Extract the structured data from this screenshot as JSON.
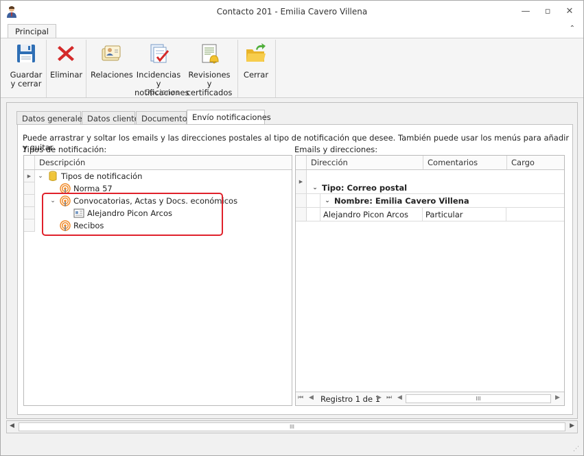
{
  "window": {
    "title": "Contacto 201 - Emilia Cavero Villena",
    "minimize": "—",
    "restore": "▫",
    "close": "✕"
  },
  "ribbon": {
    "tab": "Principal",
    "collapse": "⌃",
    "buttons": {
      "save_close": [
        "Guardar",
        "y cerrar"
      ],
      "delete": "Eliminar",
      "relations": "Relaciones",
      "incidents": [
        "Incidencias y",
        "notificaciones"
      ],
      "reviews": [
        "Revisiones y",
        "certificados"
      ],
      "close": "Cerrar"
    },
    "group_label": "Opciones"
  },
  "tabs": [
    "Datos generales",
    "Datos cliente",
    "Documentos",
    "Envío notificaciones"
  ],
  "panel": {
    "description": "Puede arrastrar y soltar los emails y las direcciones postales al tipo de notificación que desee. También puede usar los menús para añadir y quitar.",
    "left_label": "Tipos de notificación:",
    "right_label": "Emails y direcciones:"
  },
  "left_grid": {
    "header": "Descripción",
    "root": "Tipos de notificación",
    "items": [
      "Norma 57",
      "Convocatorias, Actas y Docs. económicos",
      "Alejandro Picon Arcos",
      "Recibos"
    ]
  },
  "right_grid": {
    "headers": [
      "Dirección",
      "Comentarios",
      "Cargo"
    ],
    "group_type": "Tipo: Correo postal",
    "group_name": "Nombre: Emilia Cavero Villena",
    "row": [
      "Alejandro Picon Arcos",
      "Particular",
      ""
    ],
    "navigator": "Registro 1 de 1",
    "scroll_thumb": "III"
  },
  "scrollbar": {
    "thumb": "III"
  },
  "colors": {
    "highlight": "#e0202a",
    "accent_orange": "#f08a2a"
  }
}
